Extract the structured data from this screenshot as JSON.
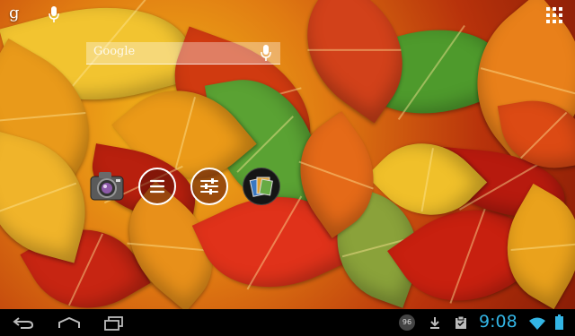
{
  "top_bar": {
    "google_letter": "g",
    "mic_icon": "microphone-icon",
    "apps_icon": "app-grid-icon"
  },
  "search_widget": {
    "logo_text": "Google",
    "mic_icon": "microphone-icon"
  },
  "home_icons": [
    {
      "name": "camera-app-icon",
      "label": ""
    },
    {
      "name": "menu-button",
      "label": ""
    },
    {
      "name": "settings-sliders-button",
      "label": ""
    },
    {
      "name": "gallery-app-icon",
      "label": ""
    }
  ],
  "nav_bar": {
    "back_icon": "back-icon",
    "home_icon": "home-icon",
    "recents_icon": "recent-apps-icon",
    "notification_badge": "96",
    "download_icon": "download-icon",
    "clipboard_icon": "clipboard-icon",
    "time": "9:08",
    "wifi_icon": "wifi-icon",
    "battery_icon": "battery-icon"
  },
  "colors": {
    "clock": "#33b5e5",
    "navbar": "#000000",
    "wallpaper_primary": "#e07a12"
  }
}
